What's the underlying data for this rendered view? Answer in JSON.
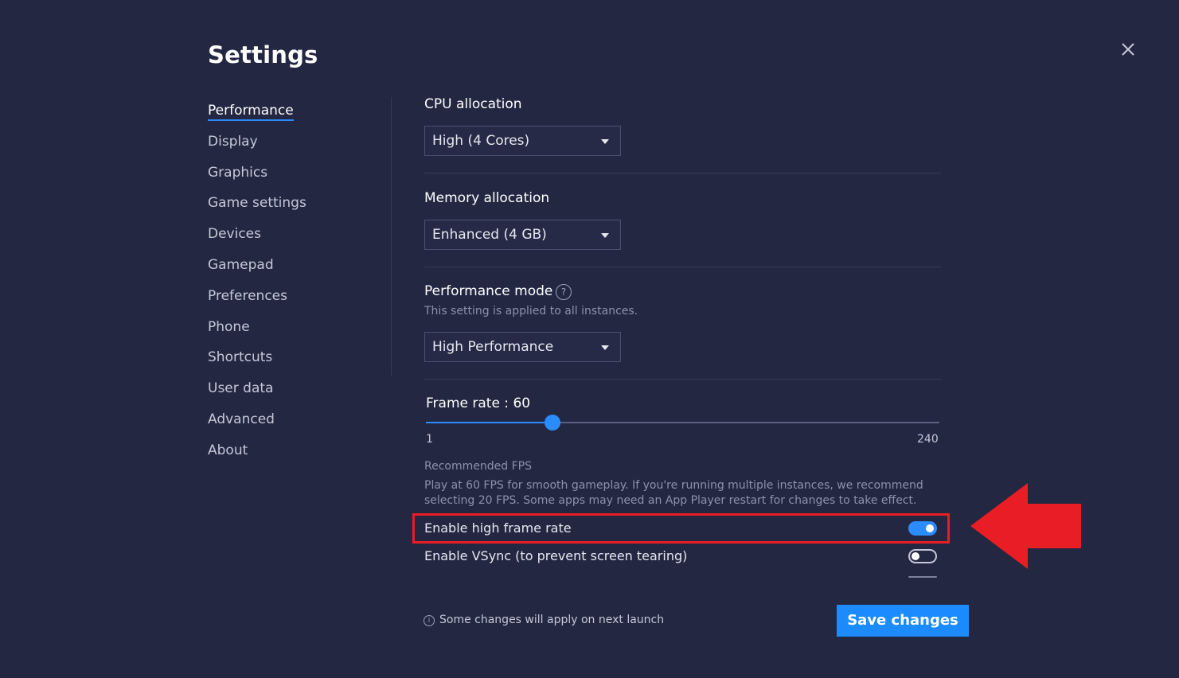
{
  "title": "Settings",
  "nav": {
    "items": [
      "Performance",
      "Display",
      "Graphics",
      "Game settings",
      "Devices",
      "Gamepad",
      "Preferences",
      "Phone",
      "Shortcuts",
      "User data",
      "Advanced",
      "About"
    ],
    "active": "Performance"
  },
  "cpu": {
    "label": "CPU allocation",
    "value": "High (4 Cores)"
  },
  "memory": {
    "label": "Memory allocation",
    "value": "Enhanced (4 GB)"
  },
  "performance_mode": {
    "label": "Performance mode",
    "help_symbol": "?",
    "note": "This setting is applied to all instances.",
    "value": "High Performance"
  },
  "frame_rate": {
    "label": "Frame rate : 60",
    "value": 60,
    "min": 1,
    "max": 240,
    "min_label": "1",
    "max_label": "240"
  },
  "recommended": {
    "title": "Recommended FPS",
    "description": "Play at 60 FPS for smooth gameplay. If you're running multiple instances, we recommend selecting 20 FPS. Some apps may need an App Player restart for changes to take effect."
  },
  "toggles": {
    "high_frame_rate": {
      "label": "Enable high frame rate",
      "on": true
    },
    "vsync": {
      "label": "Enable VSync (to prevent screen tearing)",
      "on": false
    }
  },
  "footer": {
    "info_symbol": "i",
    "note": "Some changes will apply on next launch",
    "save_label": "Save changes"
  },
  "colors": {
    "background": "#232742",
    "accent": "#2b8cff",
    "highlight": "#e81d25"
  }
}
